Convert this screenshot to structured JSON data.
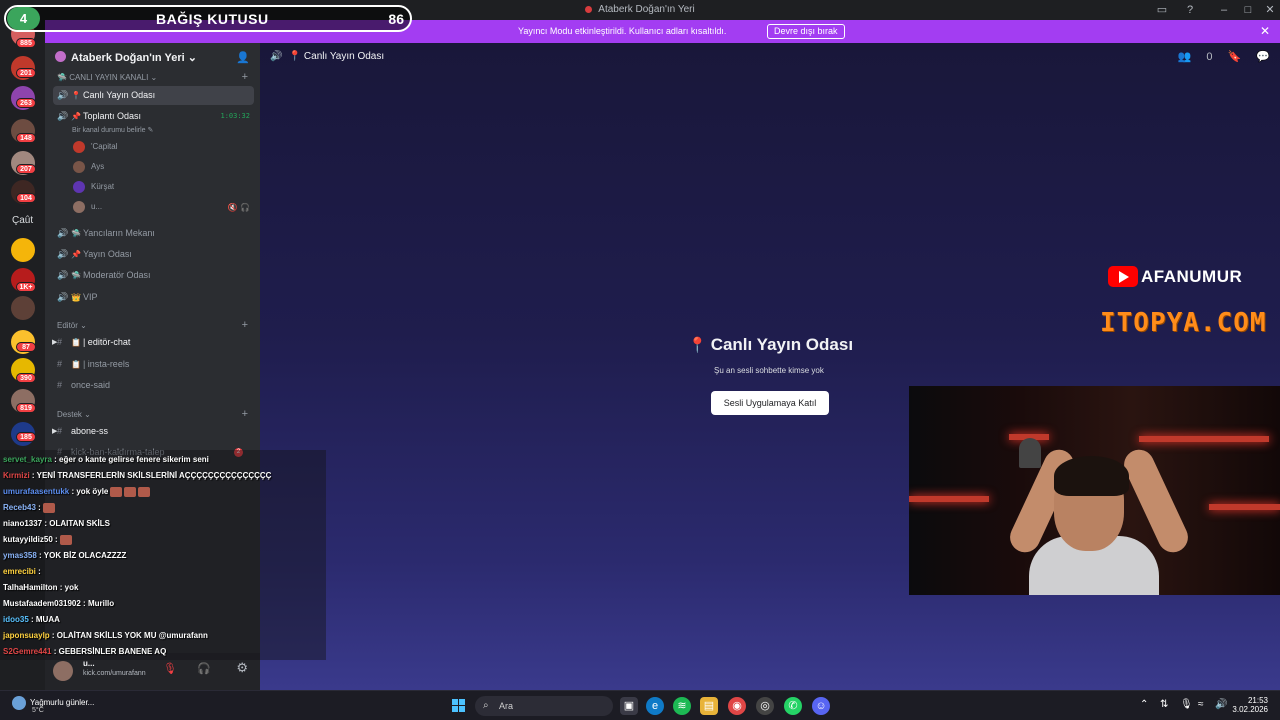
{
  "window": {
    "title": "Ataberk Doğan'ın Yeri"
  },
  "donation": {
    "badge": "4",
    "title": "BAĞIŞ KUTUSU",
    "count": "86"
  },
  "banner": {
    "text": "Yayıncı Modu etkinleştirildi. Kullanıcı adları kısaltıldı.",
    "button": "Devre dışı bırak",
    "close": "✕"
  },
  "rail": {
    "badges": [
      "885",
      "201",
      "263",
      "148",
      "207",
      "104",
      "1K+",
      "87",
      "390",
      "819",
      "185"
    ],
    "folder_label": "Çaût"
  },
  "sidebar": {
    "server_name": "Ataberk Doğan'ın Yeri",
    "categories": {
      "live": "CANLI YAYIN KANALI",
      "editor": "Editör",
      "support": "Destek"
    },
    "channels": {
      "canli": {
        "name": "Canlı Yayın Odası",
        "emoji": "📍"
      },
      "toplanti": {
        "name": "Toplantı Odası",
        "emoji": "📌",
        "timer": "1:03:32",
        "status": "Bir kanal durumu belirle ✎"
      },
      "yancilar": {
        "name": "Yancıların Mekanı",
        "emoji": "🛸"
      },
      "yayin": {
        "name": "Yayın Odası",
        "emoji": "📌"
      },
      "moderator": {
        "name": "Moderatör Odası",
        "emoji": "🛸"
      },
      "vip": {
        "name": "VIP",
        "emoji": "👑"
      },
      "editor_chat": {
        "name": "| editör-chat",
        "emoji": "📋"
      },
      "insta": {
        "name": "| insta-reels",
        "emoji": "📋"
      },
      "once": {
        "name": "once-said"
      },
      "abone": {
        "name": "abone-ss"
      },
      "kick": {
        "name": "kick-ban-kaldırma-talep",
        "badge": "2"
      }
    },
    "voice_users": [
      "'Capital",
      "Ays",
      "Kürşat",
      "u..."
    ]
  },
  "userpanel": {
    "name": "u...",
    "status": "kick.com/umurafann"
  },
  "main": {
    "header": "Canlı Yayın Odası",
    "header_count": "0",
    "title": "Canlı Yayın Odası",
    "subtitle": "Şu an sesli sohbette kimse yok",
    "join_button": "Sesli Uygulamaya Katıl"
  },
  "overlay": {
    "youtube": "AFANUMUR",
    "sponsor": "ITOPYA.COM"
  },
  "chat": [
    {
      "user": "servet_kayra",
      "text": " : eğer o kante gelirse fenere sikerim seni",
      "color": "#3ba55c"
    },
    {
      "user": "Kırmizi",
      "text": " : YENİ TRANSFERLERİN SKİLSLERİNİ AÇÇÇÇÇÇÇÇÇÇÇÇÇÇÇ",
      "color": "#e04646"
    },
    {
      "user": "umurafaasentukk",
      "text": " : yok öyle",
      "color": "#5b8def"
    },
    {
      "user": "Receb43",
      "text": " :",
      "color": "#8ab4f8"
    },
    {
      "user": "niano1337",
      "text": " : OLAITAN SKİLS",
      "color": "#ffffff"
    },
    {
      "user": "kutayyildiz50",
      "text": " :",
      "color": "#ffffff"
    },
    {
      "user": "ymas358",
      "text": " : YOK BİZ OLACAZZZZ",
      "color": "#8ab4f8"
    },
    {
      "user": "emrecibi",
      "text": " :",
      "color": "#ffd23f"
    },
    {
      "user": "TalhaHamilton",
      "text": " : yok",
      "color": "#ffffff"
    },
    {
      "user": "Mustafaadem031902",
      "text": " : Murillo",
      "color": "#ffffff"
    },
    {
      "user": "idoo35",
      "text": " : MUAA",
      "color": "#59c2ff"
    },
    {
      "user": "japonsuaylp",
      "text": " : OLAİTAN SKİLLS YOK MU @umurafann",
      "color": "#ffd23f"
    },
    {
      "user": "S2Gemre441",
      "text": " : GEBERSİNLER BANENE AQ",
      "color": "#e04646"
    }
  ],
  "taskbar": {
    "weather": "Yağmurlu günler...",
    "temp": "5°C",
    "search": "Ara",
    "time": "21:53",
    "date": "3.02.2026"
  }
}
